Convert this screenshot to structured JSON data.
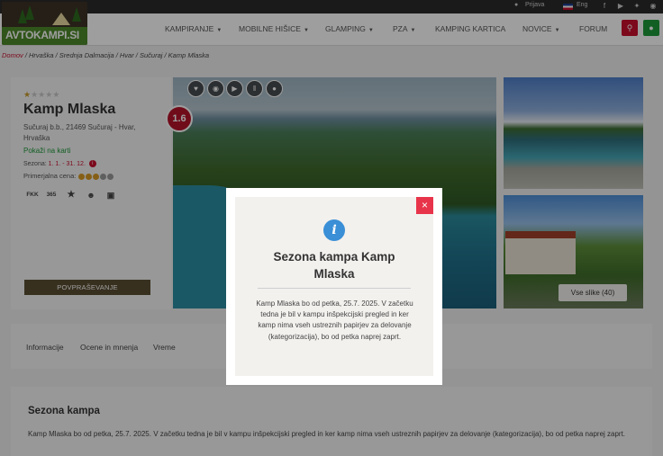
{
  "topbar": {
    "login": "Prijava",
    "language": "Eng",
    "social_icons": [
      "facebook-icon",
      "youtube-icon",
      "twitter-icon",
      "instagram-icon"
    ]
  },
  "header": {
    "logo_text": "AVTOKAMPI.SI",
    "nav": [
      {
        "label": "KAMPIRANJE",
        "has_dropdown": true
      },
      {
        "label": "MOBILNE HIŠICE",
        "has_dropdown": true
      },
      {
        "label": "GLAMPING",
        "has_dropdown": true
      },
      {
        "label": "PZA",
        "has_dropdown": true
      },
      {
        "label": "KAMPING KARTICA",
        "has_dropdown": false
      },
      {
        "label": "NOVICE",
        "has_dropdown": true
      },
      {
        "label": "FORUM",
        "has_dropdown": false
      }
    ],
    "search_icon": "search-icon",
    "map_icon": "map-marker-icon"
  },
  "breadcrumb": {
    "home": "Domov",
    "rest": " / Hrvaška / Srednja Dalmacija / Hvar / Sučuraj / Kamp Mlaska"
  },
  "camp": {
    "stars": 1,
    "stars_max": 5,
    "name": "Kamp Mlaska",
    "address": "Sučuraj b.b., 21469 Sučuraj - Hvar, Hrvaška",
    "map_link": "Pokaži na karti",
    "season_label": "Sezona:",
    "season_value": "1. 1. - 31. 12.",
    "price_label": "Primerjalna cena:",
    "price_level": 3,
    "price_max": 5,
    "amenities": [
      "FKK",
      "365"
    ],
    "amenity_icons": [
      "star-icon",
      "family-icon",
      "caravan-icon"
    ],
    "inquiry_button": "POVPRAŠEVANJE",
    "rating": "1.6"
  },
  "gallery": {
    "action_icons": [
      "heart-icon",
      "camera-icon",
      "play-icon",
      "panorama-icon",
      "location-icon"
    ],
    "all_photos_label": "Vse slike (40)"
  },
  "tabs": [
    "Informacije",
    "Ocene in mnenja",
    "Vreme"
  ],
  "section": {
    "title": "Sezona kampa",
    "text": "Kamp Mlaska bo od petka, 25.7. 2025. V začetku tedna je bil v kampu inšpekcijski pregled in ker kamp nima vseh ustreznih papirjev za delovanje (kategorizacija), bo od petka naprej zaprt."
  },
  "modal": {
    "title": "Sezona kampa Kamp Mlaska",
    "text": "Kamp Mlaska bo od petka, 25.7. 2025. V začetku tedna je bil v kampu inšpekcijski pregled in ker kamp nima vseh ustreznih papirjev za delovanje (kategorizacija), bo od petka naprej zaprt.",
    "close_icon": "close-icon",
    "info_icon": "info-icon"
  },
  "colors": {
    "accent_red": "#c8102e",
    "accent_green": "#1e9a3a",
    "button_brown": "#5b4e33",
    "info_blue": "#3a8fd6"
  }
}
